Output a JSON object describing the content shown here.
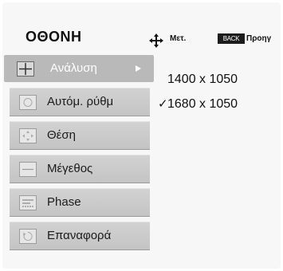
{
  "title": "ΟΘΟΝΗ",
  "hints": {
    "move_icon": "four-way-arrow-icon",
    "move_label": "Μετ.",
    "back_key": "BACK",
    "back_label": "Προηγ"
  },
  "menu": [
    {
      "label": "Ανάλυση",
      "icon": "resolution-icon",
      "selected": true
    },
    {
      "label": "Αυτόμ. ρύθμ",
      "icon": "auto-adjust-icon",
      "selected": false
    },
    {
      "label": "Θέση",
      "icon": "position-icon",
      "selected": false
    },
    {
      "label": "Μέγεθος",
      "icon": "size-icon",
      "selected": false
    },
    {
      "label": "Phase",
      "icon": "phase-icon",
      "selected": false
    },
    {
      "label": "Επαναφορά",
      "icon": "reset-icon",
      "selected": false
    }
  ],
  "options": [
    {
      "label": "1400 x 1050",
      "checked": false,
      "check_mark": ""
    },
    {
      "label": "1680 x 1050",
      "checked": true,
      "check_mark": "✓"
    }
  ],
  "colors": {
    "background": "#f7f7f7",
    "selected_row": "#b9b9b9",
    "row": "#cccccc",
    "selected_text": "#ffffff"
  }
}
